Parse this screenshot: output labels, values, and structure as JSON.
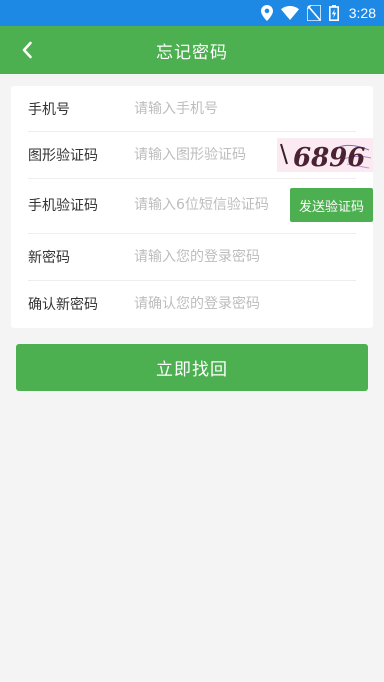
{
  "status_bar": {
    "time": "3:28",
    "icons": [
      "location-icon",
      "wifi-icon",
      "no-sim-icon",
      "battery-charging-icon"
    ]
  },
  "app_bar": {
    "title": "忘记密码",
    "back_icon": "chevron-left-icon"
  },
  "form": {
    "phone": {
      "label": "手机号",
      "placeholder": "请输入手机号",
      "value": ""
    },
    "captcha": {
      "label": "图形验证码",
      "placeholder": "请输入图形验证码",
      "value": "",
      "image_text": "6896"
    },
    "sms_code": {
      "label": "手机验证码",
      "placeholder": "请输入6位短信验证码",
      "value": "",
      "send_button": "发送验证码"
    },
    "new_password": {
      "label": "新密码",
      "placeholder": "请输入您的登录密码",
      "value": ""
    },
    "confirm_password": {
      "label": "确认新密码",
      "placeholder": "请确认您的登录密码",
      "value": ""
    }
  },
  "submit_button": "立即找回",
  "colors": {
    "status_bar": "#1e88e5",
    "primary": "#4caf50",
    "background": "#f4f4f4",
    "placeholder": "#bdbdbd",
    "label": "#333333"
  }
}
